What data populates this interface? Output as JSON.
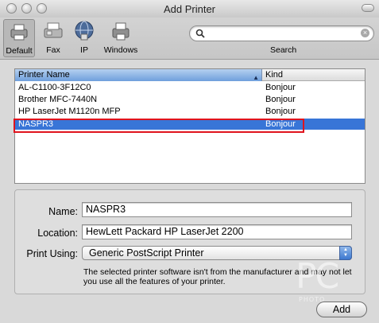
{
  "window": {
    "title": "Add Printer"
  },
  "toolbar": {
    "items": [
      {
        "label": "Default",
        "icon": "default-printer-icon",
        "selected": true
      },
      {
        "label": "Fax",
        "icon": "fax-icon",
        "selected": false
      },
      {
        "label": "IP",
        "icon": "ip-globe-icon",
        "selected": false
      },
      {
        "label": "Windows",
        "icon": "windows-printer-icon",
        "selected": false
      }
    ],
    "search_label": "Search",
    "search_value": ""
  },
  "printer_list": {
    "columns": [
      "Printer Name",
      "Kind"
    ],
    "rows": [
      {
        "name": "AL-C1100-3F12C0",
        "kind": "Bonjour"
      },
      {
        "name": "Brother MFC-7440N",
        "kind": "Bonjour"
      },
      {
        "name": "HP LaserJet M1120n MFP",
        "kind": "Bonjour"
      },
      {
        "name": "NASPR3",
        "kind": "Bonjour"
      }
    ],
    "selected_index": 3
  },
  "form": {
    "name_label": "Name:",
    "name_value": "NASPR3",
    "location_label": "Location:",
    "location_value": "HewLett Packard HP LaserJet 2200",
    "print_using_label": "Print Using:",
    "print_using_value": "Generic PostScript Printer",
    "note": "The selected printer software isn't from the manufacturer and may not let you use all the features of your printer."
  },
  "actions": {
    "add_label": "Add"
  },
  "watermark": {
    "mark": "PC",
    "sub": "PHOTO"
  },
  "colors": {
    "selection": "#3875d7",
    "highlight_border": "#e0141e"
  }
}
